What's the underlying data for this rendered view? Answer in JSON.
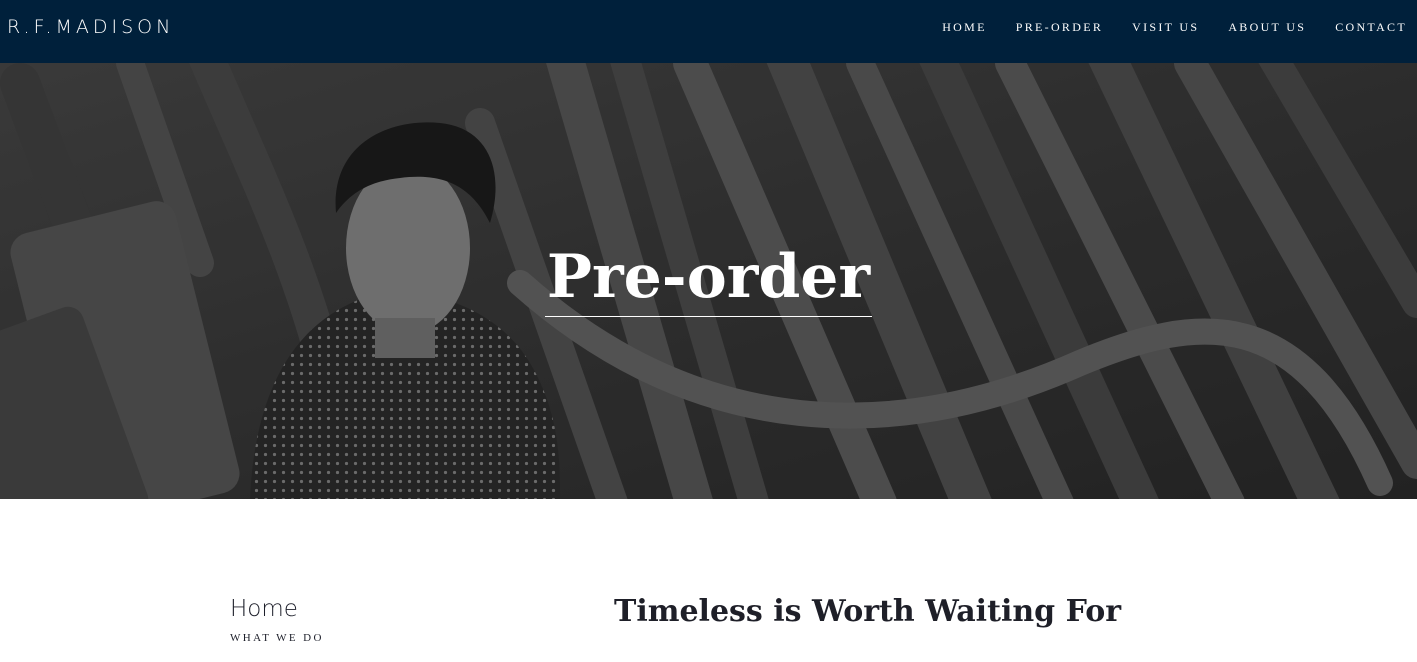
{
  "header": {
    "logo": "R.F.MADISON",
    "nav": [
      "HOME",
      "PRE-ORDER",
      "VISIT US",
      "ABOUT US",
      "CONTACT"
    ]
  },
  "hero": {
    "title": "Pre-order",
    "image_desc": "hero-photo"
  },
  "sidebar": {
    "title": "Home",
    "subtitle": "WHAT WE DO"
  },
  "main": {
    "heading": "Timeless is Worth Waiting For"
  },
  "colors": {
    "nav_bg": "#00203b",
    "text_dark": "#1d1f2a"
  }
}
